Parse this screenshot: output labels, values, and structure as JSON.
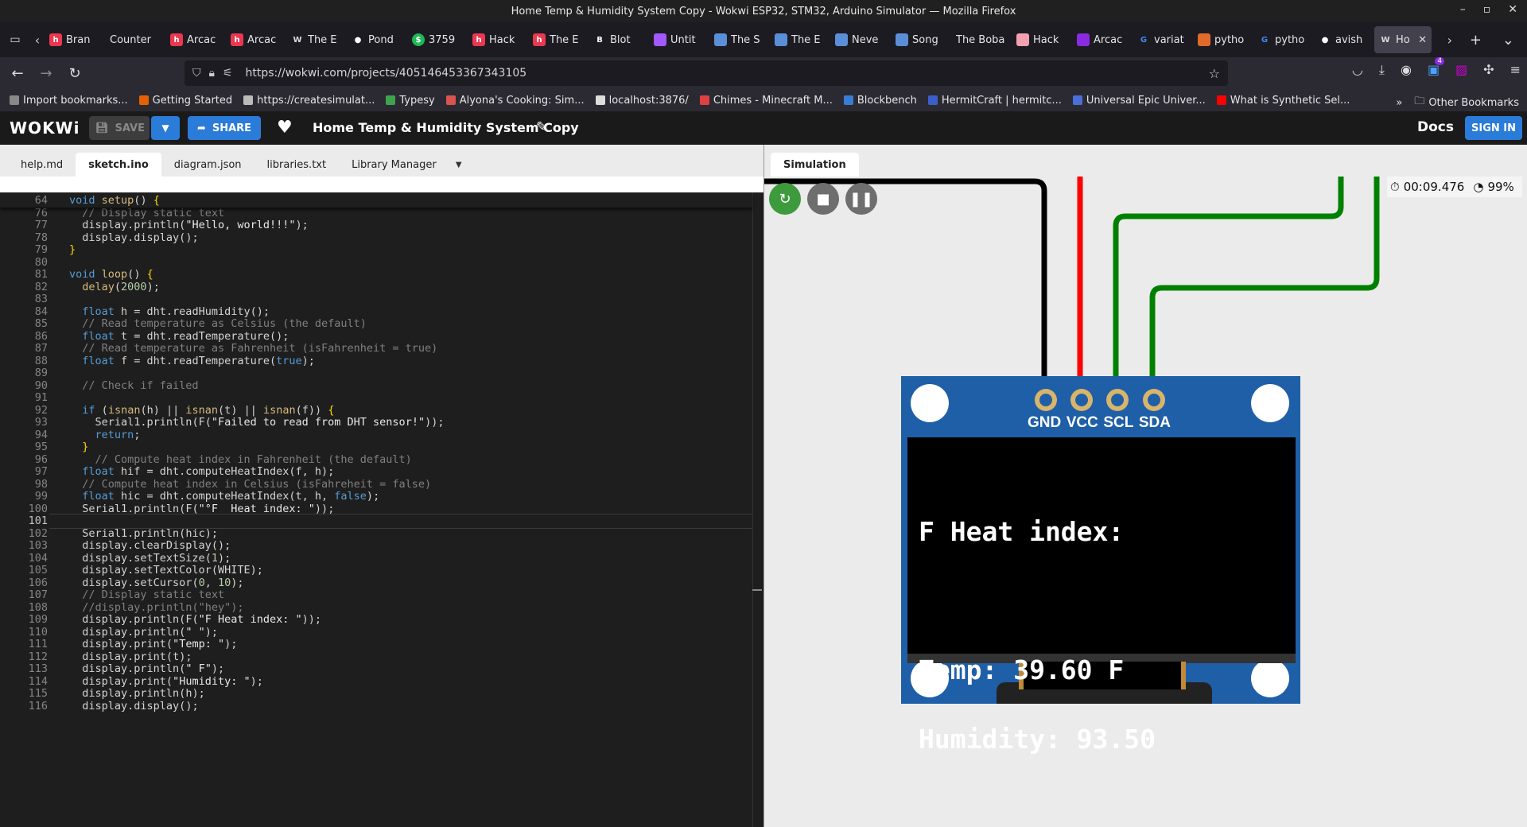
{
  "window": {
    "title": "Home Temp & Humidity System Copy - Wokwi ESP32, STM32, Arduino Simulator — Mozilla Firefox"
  },
  "tabs": [
    {
      "label": "Bran",
      "icon": "hackclub-icon",
      "color": "#ec3750"
    },
    {
      "label": "Counter",
      "icon": "none",
      "color": ""
    },
    {
      "label": "Arcac",
      "icon": "hackclub-icon",
      "color": "#ec3750"
    },
    {
      "label": "Arcac",
      "icon": "hackclub-icon",
      "color": "#ec3750"
    },
    {
      "label": "The E",
      "icon": "text-w-icon",
      "color": "#333333"
    },
    {
      "label": "Pond",
      "icon": "github-icon",
      "color": "#ffffff"
    },
    {
      "label": "3759",
      "icon": "green-circle-icon",
      "color": "#1db954"
    },
    {
      "label": "Hack",
      "icon": "hackclub-icon",
      "color": "#ec3750"
    },
    {
      "label": "The E",
      "icon": "hackclub-icon",
      "color": "#ec3750"
    },
    {
      "label": "Blot",
      "icon": "blot-icon",
      "color": "#ffffff"
    },
    {
      "label": "Untit",
      "icon": "figma-icon",
      "color": "#a259ff"
    },
    {
      "label": "The S",
      "icon": "grid-icon",
      "color": "#5a8fd8"
    },
    {
      "label": "The E",
      "icon": "grid-icon",
      "color": "#5a8fd8"
    },
    {
      "label": "Neve",
      "icon": "grid-icon",
      "color": "#5a8fd8"
    },
    {
      "label": "Song",
      "icon": "grid-icon",
      "color": "#5a8fd8"
    },
    {
      "label": "The Boba",
      "icon": "none",
      "color": ""
    },
    {
      "label": "Hack",
      "icon": "boba-icon",
      "color": "#f4a0b0"
    },
    {
      "label": "Arcac",
      "icon": "purple-square-icon",
      "color": "#8a2be2"
    },
    {
      "label": "variat",
      "icon": "google-icon",
      "color": "#ffffff"
    },
    {
      "label": "pytho",
      "icon": "flame-icon",
      "color": "#e06a2a"
    },
    {
      "label": "pytho",
      "icon": "google-icon",
      "color": "#ffffff"
    },
    {
      "label": "avish",
      "icon": "github-icon",
      "color": "#ffffff"
    },
    {
      "label": "Ho",
      "icon": "wokwi-icon",
      "color": "#cccccc",
      "active": true
    }
  ],
  "nav": {
    "url": "https://wokwi.com/projects/405146453367343105",
    "badge": "4"
  },
  "bookmarks": [
    {
      "label": "Import bookmarks...",
      "color": "#888888"
    },
    {
      "label": "Getting Started",
      "color": "#e66000"
    },
    {
      "label": "https://createsimulat...",
      "color": "#bbbbbb"
    },
    {
      "label": "Typesy",
      "color": "#3fa34d"
    },
    {
      "label": "Alyona's Cooking: Sim...",
      "color": "#d9534f"
    },
    {
      "label": "localhost:3876/",
      "color": "#dddddd"
    },
    {
      "label": "Chimes - Minecraft M...",
      "color": "#e04040"
    },
    {
      "label": "Blockbench",
      "color": "#3a7bd5"
    },
    {
      "label": "HermitCraft | hermitc...",
      "color": "#3a5fcd"
    },
    {
      "label": "Universal Epic Univer...",
      "color": "#4a6fd6"
    },
    {
      "label": "What is Synthetic Sel...",
      "color": "#ff0000"
    }
  ],
  "other_bookmarks": "Other Bookmarks",
  "wokwi": {
    "logo": "WOKWi",
    "save": "SAVE",
    "share": "SHARE",
    "project_title": "Home Temp & Humidity System Copy",
    "docs": "Docs",
    "sign_in": "SIGN IN"
  },
  "editor_tabs": [
    "help.md",
    "sketch.ino",
    "diagram.json",
    "libraries.txt",
    "Library Manager"
  ],
  "editor": {
    "sticky": {
      "num": "64",
      "text": "void setup() {"
    },
    "lines": [
      {
        "num": "76",
        "text": "  // Display static text"
      },
      {
        "num": "77",
        "text": "  display.println(\"Hello, world!!!\");"
      },
      {
        "num": "78",
        "text": "  display.display();"
      },
      {
        "num": "79",
        "text": "}"
      },
      {
        "num": "80",
        "text": ""
      },
      {
        "num": "81",
        "text": "void loop() {"
      },
      {
        "num": "82",
        "text": "  delay(2000);"
      },
      {
        "num": "83",
        "text": ""
      },
      {
        "num": "84",
        "text": "  float h = dht.readHumidity();"
      },
      {
        "num": "85",
        "text": "  // Read temperature as Celsius (the default)"
      },
      {
        "num": "86",
        "text": "  float t = dht.readTemperature();"
      },
      {
        "num": "87",
        "text": "  // Read temperature as Fahrenheit (isFahrenheit = true)"
      },
      {
        "num": "88",
        "text": "  float f = dht.readTemperature(true);"
      },
      {
        "num": "89",
        "text": ""
      },
      {
        "num": "90",
        "text": "  // Check if failed"
      },
      {
        "num": "91",
        "text": ""
      },
      {
        "num": "92",
        "text": "  if (isnan(h) || isnan(t) || isnan(f)) {"
      },
      {
        "num": "93",
        "text": "    Serial1.println(F(\"Failed to read from DHT sensor!\"));"
      },
      {
        "num": "94",
        "text": "    return;"
      },
      {
        "num": "95",
        "text": "  }"
      },
      {
        "num": "96",
        "text": "    // Compute heat index in Fahrenheit (the default)"
      },
      {
        "num": "97",
        "text": "  float hif = dht.computeHeatIndex(f, h);"
      },
      {
        "num": "98",
        "text": "  // Compute heat index in Celsius (isFahreheit = false)"
      },
      {
        "num": "99",
        "text": "  float hic = dht.computeHeatIndex(t, h, false);"
      },
      {
        "num": "100",
        "text": "  Serial1.println(F(\"°F  Heat index: \"));"
      },
      {
        "num": "101",
        "text": "",
        "current": true
      },
      {
        "num": "102",
        "text": "  Serial1.println(hic);"
      },
      {
        "num": "103",
        "text": "  display.clearDisplay();"
      },
      {
        "num": "104",
        "text": "  display.setTextSize(1);"
      },
      {
        "num": "105",
        "text": "  display.setTextColor(WHITE);"
      },
      {
        "num": "106",
        "text": "  display.setCursor(0, 10);"
      },
      {
        "num": "107",
        "text": "  // Display static text"
      },
      {
        "num": "108",
        "text": "  //display.println(\"hey\");"
      },
      {
        "num": "109",
        "text": "  display.println(F(\"F Heat index: \"));"
      },
      {
        "num": "110",
        "text": "  display.println(\" \");"
      },
      {
        "num": "111",
        "text": "  display.print(\"Temp: \");"
      },
      {
        "num": "112",
        "text": "  display.print(t);"
      },
      {
        "num": "113",
        "text": "  display.println(\" F\");"
      },
      {
        "num": "114",
        "text": "  display.print(\"Humidity: \");"
      },
      {
        "num": "115",
        "text": "  display.println(h);"
      },
      {
        "num": "116",
        "text": "  display.display();"
      }
    ]
  },
  "simulation": {
    "tab": "Simulation",
    "timer": "00:09.476",
    "speed": "99%",
    "pins": [
      "GND",
      "VCC",
      "SCL",
      "SDA"
    ],
    "oled": {
      "line1": "F Heat index:",
      "line2": "Temp: 39.60 F",
      "line3": "Humidity: 93.50"
    },
    "colors": {
      "gnd_wire": "#000000",
      "vcc_wire": "#ff0000",
      "data_wire": "#008000",
      "board": "#1f5fa8"
    }
  }
}
